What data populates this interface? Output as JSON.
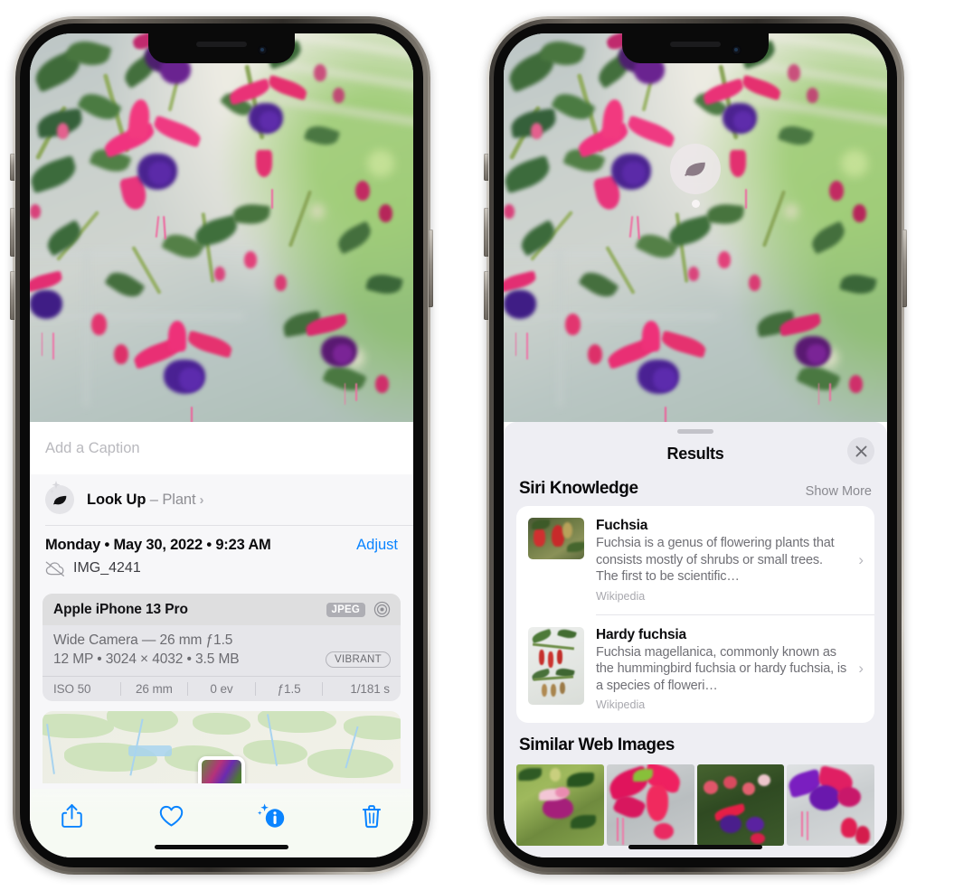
{
  "left_phone": {
    "photo": {
      "alt_name": "fuchsia-flowers-photo"
    },
    "caption_field": {
      "placeholder": "Add a Caption",
      "value": ""
    },
    "look_up": {
      "label": "Look Up",
      "dash": " – ",
      "subject": "Plant",
      "chevron": "›",
      "icon": "leaf-icon",
      "sparkle_icon": "sparkle-icon"
    },
    "metadata": {
      "date": "Monday • May 30, 2022 • 9:23 AM",
      "adjust_label": "Adjust",
      "filename": "IMG_4241",
      "cloud_icon": "icloud-slash-icon"
    },
    "camera_card": {
      "device": "Apple iPhone 13 Pro",
      "format_badge": "JPEG",
      "aperture_icon": "aperture-icon",
      "lens_line": "Wide Camera — 26 mm ƒ1.5",
      "size_line": "12 MP • 3024 × 4032 • 3.5 MB",
      "style_badge": "VIBRANT",
      "exif": [
        "ISO 50",
        "26 mm",
        "0 ev",
        "ƒ1.5",
        "1/181 s"
      ]
    },
    "map": {
      "name": "location-map-thumbnail",
      "pin": "photo-pin"
    },
    "toolbar": {
      "share": "share-icon",
      "favorite": "heart-icon",
      "info": "info-visual-lookup-icon",
      "delete": "trash-icon"
    }
  },
  "right_phone": {
    "badge": {
      "icon": "leaf-icon",
      "name": "visual-lookup-badge"
    },
    "sheet": {
      "title": "Results",
      "close_icon": "close-icon",
      "grabber": "drag-handle"
    },
    "siri_knowledge": {
      "title": "Siri Knowledge",
      "show_more": "Show More",
      "items": [
        {
          "title": "Fuchsia",
          "description": "Fuchsia is a genus of flowering plants that consists mostly of shrubs or small trees. The first to be scientific…",
          "source": "Wikipedia",
          "chevron": "›"
        },
        {
          "title": "Hardy fuchsia",
          "description": "Fuchsia magellanica, commonly known as the hummingbird fuchsia or hardy fuchsia, is a species of floweri…",
          "source": "Wikipedia",
          "chevron": "›"
        }
      ]
    },
    "similar_web_images": {
      "title": "Similar Web Images",
      "count": 4
    }
  },
  "colors": {
    "accent_blue": "#0a84ff",
    "sheet_bg": "#eeeef3",
    "card_white": "#ffffff",
    "secondary_text": "#8e8e93",
    "camera_card_bg": "#e6e6ea"
  }
}
